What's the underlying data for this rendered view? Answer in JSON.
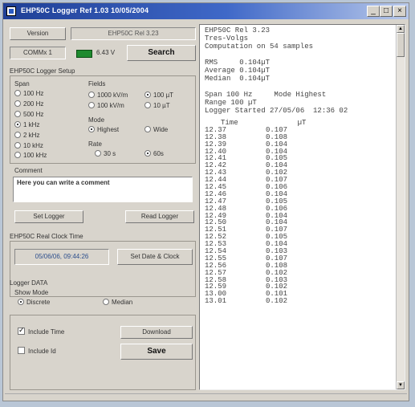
{
  "window": {
    "title": "EHP50C Logger Ref 1.03 10/05/2004",
    "controls": [
      "_",
      "□",
      "×"
    ]
  },
  "header": {
    "version_button": "Version",
    "version_value": "EHP50C Rel 3.23",
    "port_value": "COMMx 1",
    "battery_value": "6.43 V",
    "search_button": "Search"
  },
  "setup": {
    "title": "EHP50C Logger Setup",
    "span_label": "Span",
    "span_options": [
      "100 Hz",
      "200 Hz",
      "500 Hz",
      "1 kHz",
      "2 kHz",
      "10 kHz",
      "100 kHz"
    ],
    "span_selected": "1 kHz",
    "fields_label": "Fields",
    "fields_options": [
      "1000 kV/m",
      "100 µT",
      "100 kV/m",
      "10 µT"
    ],
    "fields_selected": "100 µT",
    "mode_label": "Mode",
    "mode_options": [
      "Highest",
      "Wide"
    ],
    "mode_selected": "Highest",
    "rate_label": "Rate",
    "rate_options": [
      "30 s",
      "60s"
    ],
    "rate_selected": "60s"
  },
  "comment": {
    "label": "Comment",
    "value": "Here you can write a comment"
  },
  "buttons": {
    "set_logger": "Set Logger",
    "read_logger": "Read Logger"
  },
  "clock": {
    "title": "EHP50C Real Clock Time",
    "value": "05/06/06, 09:44:26",
    "set_button": "Set Date & Clock"
  },
  "logger_data": {
    "title": "Logger DATA",
    "show_mode_label": "Show Mode",
    "show_mode_options": [
      "Discrete",
      "Median"
    ],
    "show_mode_selected": "Discrete",
    "include_time": "Include Time",
    "include_time_checked": true,
    "include_id": "Include Id",
    "include_id_checked": false,
    "download_button": "Download",
    "save_button": "Save"
  },
  "output": {
    "header_lines": [
      "EHP50C Rel 3.23",
      "Tres-Volgs",
      "Computation on 54 samples",
      "",
      "RMS     0.104µT",
      "Average 0.104µT",
      "Median  0.104µT",
      "",
      "Span 100 Hz     Mode Highest",
      "Range 100 µT",
      "Logger Started 27/05/06  12:36 02"
    ],
    "col_time": "Time",
    "col_value": "µT",
    "rows": [
      [
        "12.37",
        "0.107"
      ],
      [
        "12.38",
        "0.108"
      ],
      [
        "12.39",
        "0.104"
      ],
      [
        "12.40",
        "0.104"
      ],
      [
        "12.41",
        "0.105"
      ],
      [
        "12.42",
        "0.104"
      ],
      [
        "12.43",
        "0.102"
      ],
      [
        "12.44",
        "0.107"
      ],
      [
        "12.45",
        "0.106"
      ],
      [
        "12.46",
        "0.104"
      ],
      [
        "12.47",
        "0.105"
      ],
      [
        "12.48",
        "0.106"
      ],
      [
        "12.49",
        "0.104"
      ],
      [
        "12.50",
        "0.104"
      ],
      [
        "12.51",
        "0.107"
      ],
      [
        "12.52",
        "0.105"
      ],
      [
        "12.53",
        "0.104"
      ],
      [
        "12.54",
        "0.103"
      ],
      [
        "12.55",
        "0.107"
      ],
      [
        "12.56",
        "0.108"
      ],
      [
        "12.57",
        "0.102"
      ],
      [
        "12.58",
        "0.103"
      ],
      [
        "12.59",
        "0.102"
      ],
      [
        "13.00",
        "0.101"
      ],
      [
        "13.01",
        "0.102"
      ]
    ]
  }
}
